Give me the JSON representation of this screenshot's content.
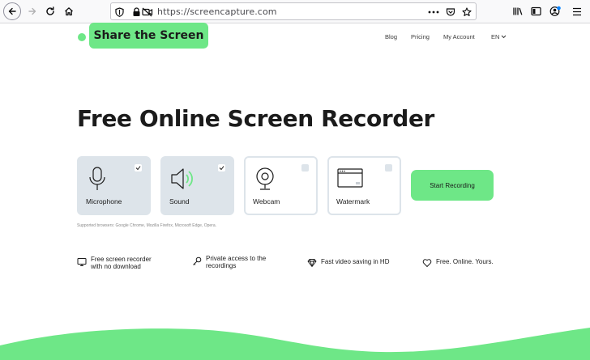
{
  "browser": {
    "url": "https://screencapture.com",
    "icons": [
      "back-icon",
      "forward-icon",
      "reload-icon",
      "home-icon",
      "shield-icon",
      "lock-icon",
      "camera-blocked-icon",
      "more-icon",
      "pocket-icon",
      "bookmark-star-icon",
      "library-icon",
      "sidebar-icon",
      "account-icon",
      "menu-icon"
    ]
  },
  "site": {
    "logo": "Share the Screen",
    "nav": {
      "blog": "Blog",
      "pricing": "Pricing",
      "account": "My Account",
      "lang": "EN"
    },
    "headline": "Free Online Screen Recorder",
    "options": [
      {
        "label": "Microphone",
        "checked": true,
        "icon": "microphone-icon"
      },
      {
        "label": "Sound",
        "checked": true,
        "icon": "speaker-icon"
      },
      {
        "label": "Webcam",
        "checked": false,
        "icon": "webcam-icon"
      },
      {
        "label": "Watermark",
        "checked": false,
        "icon": "watermark-icon"
      }
    ],
    "start_button": "Start Recording",
    "supported": "Supported browsers: Google Chrome, Mozilla Firefox, Microsoft Edge, Opera.",
    "features": [
      {
        "line1": "Free screen recorder",
        "line2": "with no download",
        "icon": "monitor-icon"
      },
      {
        "line1": "Private access to the",
        "line2": "recordings",
        "icon": "key-icon"
      },
      {
        "line1": "Fast video saving in HD",
        "line2": "",
        "icon": "diamond-icon"
      },
      {
        "line1": "Free. Online. Yours.",
        "line2": "",
        "icon": "heart-icon"
      }
    ],
    "colors": {
      "accent": "#6ee787",
      "card": "#dde4ea",
      "text": "#1b1b1b"
    }
  }
}
